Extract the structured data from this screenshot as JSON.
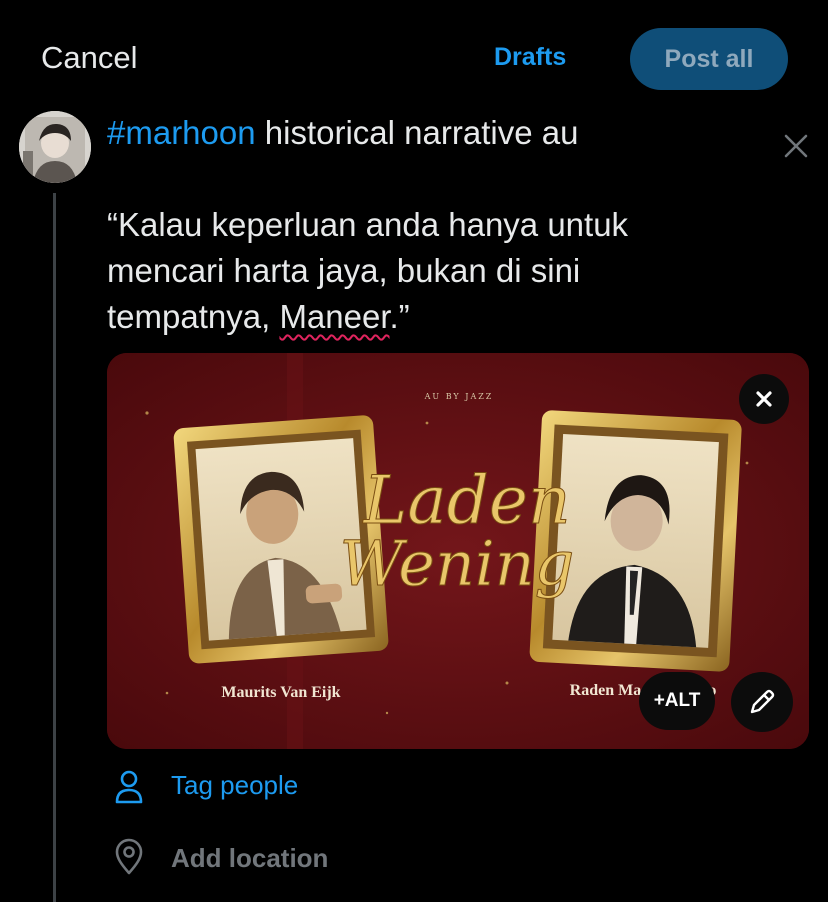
{
  "topbar": {
    "cancel_label": "Cancel",
    "drafts_label": "Drafts",
    "post_all_label": "Post all"
  },
  "composer": {
    "avatar_icon": "user-avatar",
    "hashtag": "#marhoon",
    "headline_rest": " historical narrative au",
    "remove_icon": "close-icon",
    "body_lines": [
      "“Kalau keperluan anda hanya untuk",
      "mencari harta jaya, bukan di sini"
    ],
    "body_line3_prefix": "tempatnya, ",
    "body_misspelled": "Maneer",
    "body_line3_suffix": ".”"
  },
  "media": {
    "credit": "AU BY JAZZ",
    "title_line1": "Laden",
    "title_line2": "Wening",
    "left_caption": "Maurits Van Eijk",
    "right_caption": "Raden Mas Djatmiko",
    "remove_icon": "close-icon",
    "alt_label": "+ALT",
    "edit_icon": "pencil-icon",
    "colors": {
      "background": "#5e0c0f",
      "frame_gold": "#c9a23c",
      "title_gold": "#e9c66a"
    }
  },
  "actions": {
    "tag_people_label": "Tag people",
    "tag_people_icon": "person-icon",
    "add_location_label": "Add location",
    "add_location_icon": "location-pin-icon"
  },
  "colors": {
    "accent": "#1d9bf0",
    "post_button_bg": "#0f4e78",
    "muted_text": "#71767b"
  }
}
